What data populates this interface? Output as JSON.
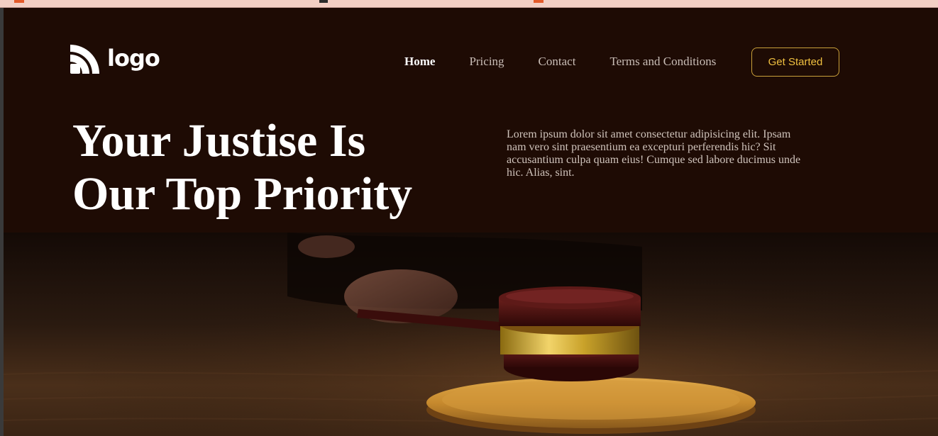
{
  "logo": {
    "text": "logo",
    "icon": "signal-arcs-icon"
  },
  "nav": {
    "items": [
      {
        "label": "Home",
        "active": true
      },
      {
        "label": "Pricing",
        "active": false
      },
      {
        "label": "Contact",
        "active": false
      },
      {
        "label": "Terms and Conditions",
        "active": false
      }
    ],
    "cta_label": "Get Started"
  },
  "hero": {
    "headline_line1": "Your Justise Is",
    "headline_line2": "Our Top Priority",
    "lead": "Lorem ipsum dolor sit amet consectetur adipisicing elit. Ipsam nam vero sint praesentium ea excepturi perferendis hic? Sit accusantium culpa quam eius! Cumque sed labore ducimus unde hic. Alias, sint.",
    "image": "judge-gavel-photo"
  },
  "colors": {
    "background": "#1e0b04",
    "accent_gold": "#f0c040",
    "cta_border": "#c9a03a",
    "text_muted": "#cfc3bb"
  }
}
